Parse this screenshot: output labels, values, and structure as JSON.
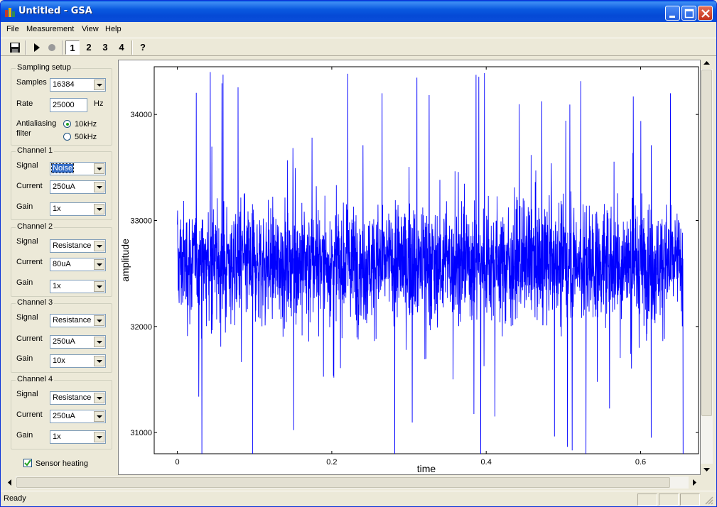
{
  "window": {
    "title": "Untitled - GSA"
  },
  "menu": {
    "file": "File",
    "measurement": "Measurement",
    "view": "View",
    "help": "Help"
  },
  "toolbar": {
    "ch1": "1",
    "ch2": "2",
    "ch3": "3",
    "ch4": "4",
    "help_glyph": "?"
  },
  "sampling": {
    "title": "Sampling setup",
    "samples_label": "Samples",
    "samples_value": "16384",
    "rate_label": "Rate",
    "rate_value": "25000",
    "rate_unit": "Hz",
    "filter_label_1": "Antialiasing",
    "filter_label_2": "filter",
    "opt1": "10kHz",
    "opt2": "50kHz",
    "selected": "10kHz"
  },
  "channels": [
    {
      "title": "Channel 1",
      "signal_label": "Signal",
      "signal": "Noise",
      "current_label": "Current",
      "current": "250uA",
      "gain_label": "Gain",
      "gain": "1x"
    },
    {
      "title": "Channel 2",
      "signal_label": "Signal",
      "signal": "Resistance",
      "current_label": "Current",
      "current": "80uA",
      "gain_label": "Gain",
      "gain": "1x"
    },
    {
      "title": "Channel 3",
      "signal_label": "Signal",
      "signal": "Resistance",
      "current_label": "Current",
      "current": "250uA",
      "gain_label": "Gain",
      "gain": "10x"
    },
    {
      "title": "Channel 4",
      "signal_label": "Signal",
      "signal": "Resistance",
      "current_label": "Current",
      "current": "250uA",
      "gain_label": "Gain",
      "gain": "1x"
    }
  ],
  "sensor_heating": {
    "label": "Sensor heating",
    "checked": true
  },
  "status": {
    "text": "Ready"
  },
  "colors": {
    "trace": "#0000ff",
    "titlebar": "#0a5ae0"
  },
  "chart_data": {
    "type": "line",
    "xlabel": "time",
    "ylabel": "amplitude",
    "title": "",
    "xlim": [
      -0.03,
      0.675
    ],
    "ylim": [
      30800,
      34450
    ],
    "xticks": [
      0,
      0.2,
      0.4,
      0.6
    ],
    "xtick_labels": [
      "0",
      "0.2",
      "0.4",
      "0.6"
    ],
    "yticks": [
      31000,
      32000,
      33000,
      34000
    ],
    "ytick_labels": [
      "31000",
      "32000",
      "33000",
      "34000"
    ],
    "signal": {
      "x_start": 0,
      "x_end": 0.655,
      "mean": 32600,
      "envelope_low": 32050,
      "envelope_high": 33200,
      "min": 30800,
      "max": 34400
    },
    "grid": false
  }
}
